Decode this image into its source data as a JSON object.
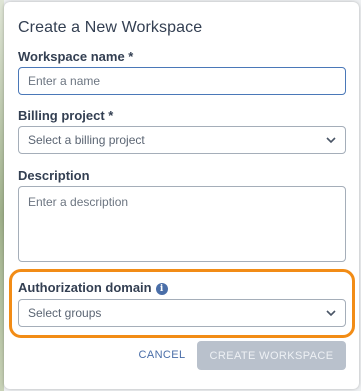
{
  "dialog": {
    "title": "Create a New Workspace",
    "workspace_name": {
      "label": "Workspace name *",
      "placeholder": "Enter a name",
      "value": ""
    },
    "billing_project": {
      "label": "Billing project *",
      "placeholder": "Select a billing project"
    },
    "description": {
      "label": "Description",
      "placeholder": "Enter a description",
      "value": ""
    },
    "authorization_domain": {
      "label": "Authorization domain",
      "info_icon_glyph": "i",
      "placeholder": "Select groups"
    },
    "buttons": {
      "cancel": "CANCEL",
      "create": "CREATE WORKSPACE"
    }
  },
  "icons": [
    "info-icon",
    "chevron-down-icon"
  ],
  "colors": {
    "text": "#333f52",
    "accent": "#4a6ea8",
    "highlight": "#f28c16",
    "disabled_button": "#b9c1cc"
  }
}
